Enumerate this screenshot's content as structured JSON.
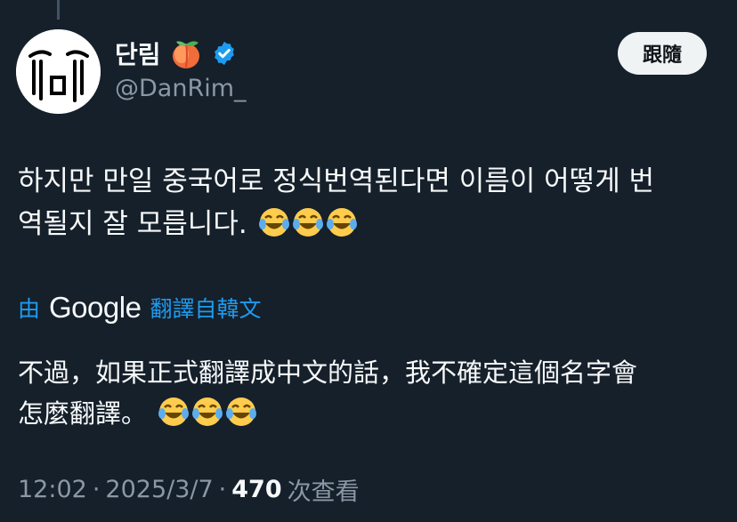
{
  "author": {
    "display_name": "단림",
    "handle": "@DanRim_",
    "verified": true,
    "avatar_icon": "crying-face-doodle"
  },
  "follow_label": "跟隨",
  "tweet": {
    "line1": "하지만 만일 중국어로 정식번역된다면 이름이 어떻게 번",
    "line2": "역될지 잘 모릅니다.",
    "emoji_count": 3
  },
  "translation": {
    "by_label": "由",
    "provider": "Google",
    "from_label": "翻譯自韓文",
    "line1": "不過，如果正式翻譯成中文的話，我不確定這個名字會",
    "line2": "怎麼翻譯。",
    "emoji_count": 3
  },
  "meta": {
    "time": "12:02",
    "date": "2025/3/7",
    "separator": "·",
    "views": "470",
    "views_label": "次查看"
  },
  "colors": {
    "background": "#15202b",
    "accent": "#1d9bf0",
    "text": "#f7f9f9",
    "secondary": "#8b98a5"
  }
}
